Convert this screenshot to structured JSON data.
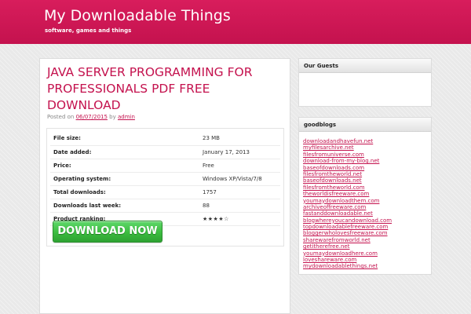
{
  "header": {
    "site_title": "My Downloadable Things",
    "tagline": "software, games and things"
  },
  "post": {
    "title": "JAVA SERVER PROGRAMMING FOR PROFESSIONALS PDF FREE DOWNLOAD",
    "meta_prefix": "Posted on",
    "date": "06/07/2015",
    "by_word": "by",
    "author": "admin"
  },
  "info": {
    "rows": [
      {
        "label": "File size:",
        "value": "23 MB"
      },
      {
        "label": "Date added:",
        "value": "January 17, 2013"
      },
      {
        "label": "Price:",
        "value": "Free"
      },
      {
        "label": "Operating system:",
        "value": "Windows XP/Vista/7/8"
      },
      {
        "label": "Total downloads:",
        "value": "1757"
      },
      {
        "label": "Downloads last week:",
        "value": "88"
      },
      {
        "label": "Product ranking:",
        "value": "★★★★☆"
      }
    ],
    "rating_stars": 4,
    "rating_max": 5
  },
  "download_button": {
    "label": "DOWNLOAD NOW"
  },
  "sidebar": {
    "guests_title": "Our Guests",
    "blogs_title": "goodblogs",
    "blogs": [
      "downloadandhavefun.net",
      "myfilesarchive.net",
      "filesfromuniverse.com",
      "download-from-my-blog.net",
      "baseofdownloads.com",
      "filesfromtheworld.net",
      "baseofdownloads.net",
      "filesfromtheworld.com",
      "theworldisfreeware.com",
      "youmaydownloadthem.com",
      "archiveoffreeware.com",
      "fastanddownloadable.net",
      "blogwhereyoucandownload.com",
      "topdownloadablefreeware.com",
      "bloggerwholovesfreeware.com",
      "sharewarefromworld.net",
      "getitherefree.net",
      "youmaydownloadhere.com",
      "loveshareware.com",
      "mydownloadablethings.net"
    ]
  },
  "colors": {
    "accent": "#c4124e",
    "header_top": "#d81d5c",
    "button_green": "#3bbc3f"
  }
}
